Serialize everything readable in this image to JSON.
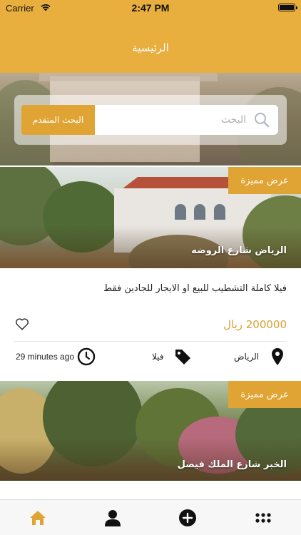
{
  "status_bar": {
    "carrier": "Carrier",
    "time": "2:47 PM"
  },
  "nav": {
    "title": "الرئيسية"
  },
  "search": {
    "placeholder": "البحث",
    "advanced_label": "البحث المتقدم"
  },
  "featured_badge": "عرض مميزة",
  "listings": [
    {
      "photo_title": "الرياض شارع الروضه",
      "description": "فيلا كاملة التشطيب للبيع او الايجار للجادين فقط",
      "price": "200000 ريال",
      "city": "الرياض",
      "type": "فيلا",
      "time_ago": "29 minutes ago"
    },
    {
      "photo_title": "الخبر شارع الملك فيصل"
    }
  ],
  "tabbar": {
    "items": [
      {
        "name": "home-icon",
        "active": true
      },
      {
        "name": "user-icon",
        "active": false
      },
      {
        "name": "add-icon",
        "active": false
      },
      {
        "name": "more-grid-icon",
        "active": false
      }
    ]
  },
  "colors": {
    "accent": "#E8AE3E",
    "button": "#E0A434",
    "price": "#D9A034"
  }
}
